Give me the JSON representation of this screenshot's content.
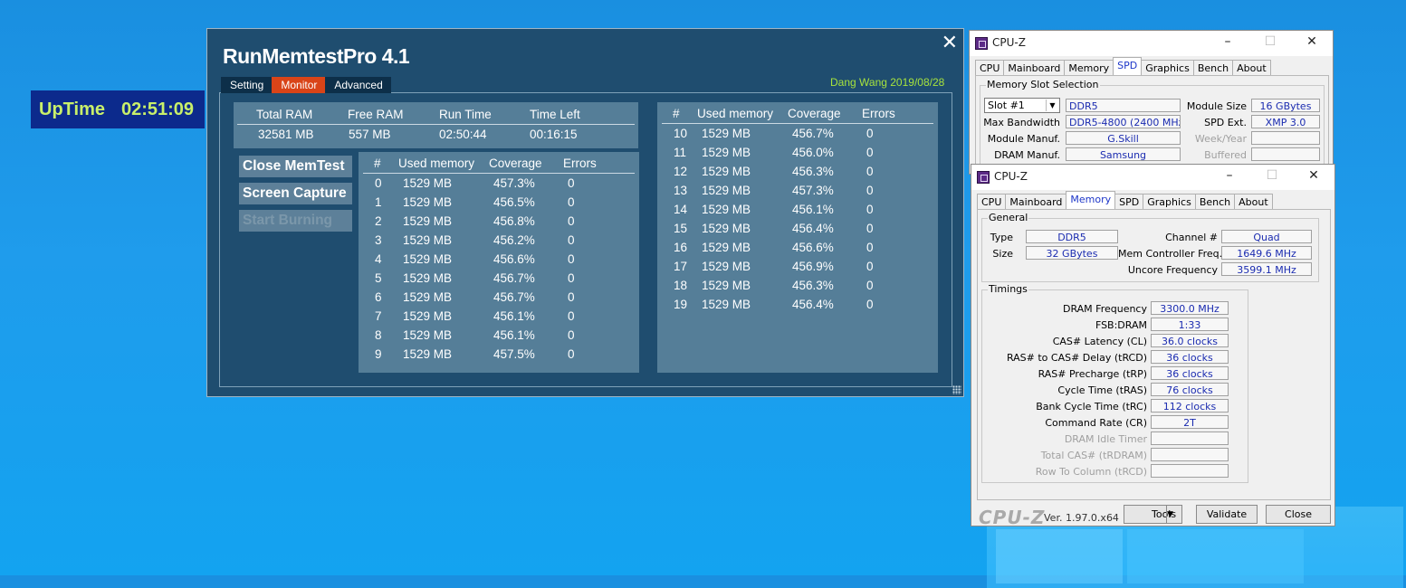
{
  "uptime": {
    "label": "UpTime",
    "value": "02:51:09"
  },
  "runmemtest": {
    "title": "RunMemtestPro 4.1",
    "tabs": [
      {
        "label": "Setting",
        "active": false
      },
      {
        "label": "Monitor",
        "active": true
      },
      {
        "label": "Advanced",
        "active": false
      }
    ],
    "author": "Dang Wang 2019/08/28",
    "summary": {
      "headers": [
        "Total RAM",
        "Free RAM",
        "Run Time",
        "Time Left"
      ],
      "values": [
        "32581 MB",
        "557 MB",
        "02:50:44",
        "00:16:15"
      ]
    },
    "buttons": {
      "close": "Close MemTest",
      "capture": "Screen Capture",
      "burn": "Start Burning"
    },
    "table_headers": [
      "#",
      "Used memory",
      "Coverage",
      "Errors"
    ],
    "left_rows": [
      [
        "0",
        "1529 MB",
        "457.3%",
        "0"
      ],
      [
        "1",
        "1529 MB",
        "456.5%",
        "0"
      ],
      [
        "2",
        "1529 MB",
        "456.8%",
        "0"
      ],
      [
        "3",
        "1529 MB",
        "456.2%",
        "0"
      ],
      [
        "4",
        "1529 MB",
        "456.6%",
        "0"
      ],
      [
        "5",
        "1529 MB",
        "456.7%",
        "0"
      ],
      [
        "6",
        "1529 MB",
        "456.7%",
        "0"
      ],
      [
        "7",
        "1529 MB",
        "456.1%",
        "0"
      ],
      [
        "8",
        "1529 MB",
        "456.1%",
        "0"
      ],
      [
        "9",
        "1529 MB",
        "457.5%",
        "0"
      ]
    ],
    "right_rows": [
      [
        "10",
        "1529 MB",
        "456.7%",
        "0"
      ],
      [
        "11",
        "1529 MB",
        "456.0%",
        "0"
      ],
      [
        "12",
        "1529 MB",
        "456.3%",
        "0"
      ],
      [
        "13",
        "1529 MB",
        "457.3%",
        "0"
      ],
      [
        "14",
        "1529 MB",
        "456.1%",
        "0"
      ],
      [
        "15",
        "1529 MB",
        "456.4%",
        "0"
      ],
      [
        "16",
        "1529 MB",
        "456.6%",
        "0"
      ],
      [
        "17",
        "1529 MB",
        "456.9%",
        "0"
      ],
      [
        "18",
        "1529 MB",
        "456.3%",
        "0"
      ],
      [
        "19",
        "1529 MB",
        "456.4%",
        "0"
      ]
    ]
  },
  "cpuz_tabs": [
    "CPU",
    "Mainboard",
    "Memory",
    "SPD",
    "Graphics",
    "Bench",
    "About"
  ],
  "cpuz_spd": {
    "title": "CPU-Z",
    "active_tab": "SPD",
    "group": "Memory Slot Selection",
    "slot": "Slot #1",
    "type": "DDR5",
    "module_size_label": "Module Size",
    "module_size": "16 GBytes",
    "max_bw_label": "Max Bandwidth",
    "max_bw": "DDR5-4800 (2400 MHz)",
    "spd_ext_label": "SPD Ext.",
    "spd_ext": "XMP 3.0",
    "module_manuf_label": "Module Manuf.",
    "module_manuf": "G.Skill",
    "week_year_label": "Week/Year",
    "dram_manuf_label": "DRAM Manuf.",
    "dram_manuf": "Samsung",
    "buffered_label": "Buffered"
  },
  "cpuz_mem": {
    "title": "CPU-Z",
    "active_tab": "Memory",
    "general_title": "General",
    "type_label": "Type",
    "type": "DDR5",
    "size_label": "Size",
    "size": "32 GBytes",
    "channel_label": "Channel #",
    "channel": "Quad",
    "mcf_label": "Mem Controller Freq.",
    "mcf": "1649.6 MHz",
    "uncore_label": "Uncore Frequency",
    "uncore": "3599.1 MHz",
    "timings_title": "Timings",
    "timings": [
      {
        "label": "DRAM Frequency",
        "value": "3300.0 MHz",
        "dim": false
      },
      {
        "label": "FSB:DRAM",
        "value": "1:33",
        "dim": false
      },
      {
        "label": "CAS# Latency (CL)",
        "value": "36.0 clocks",
        "dim": false
      },
      {
        "label": "RAS# to CAS# Delay (tRCD)",
        "value": "36 clocks",
        "dim": false
      },
      {
        "label": "RAS# Precharge (tRP)",
        "value": "36 clocks",
        "dim": false
      },
      {
        "label": "Cycle Time (tRAS)",
        "value": "76 clocks",
        "dim": false
      },
      {
        "label": "Bank Cycle Time (tRC)",
        "value": "112 clocks",
        "dim": false
      },
      {
        "label": "Command Rate (CR)",
        "value": "2T",
        "dim": false
      },
      {
        "label": "DRAM Idle Timer",
        "value": "",
        "dim": true
      },
      {
        "label": "Total CAS# (tRDRAM)",
        "value": "",
        "dim": true
      },
      {
        "label": "Row To Column (tRCD)",
        "value": "",
        "dim": true
      }
    ],
    "brand": "CPU-Z",
    "version": "Ver. 1.97.0.x64",
    "tools_label": "Tools",
    "validate_label": "Validate",
    "close_label": "Close"
  }
}
